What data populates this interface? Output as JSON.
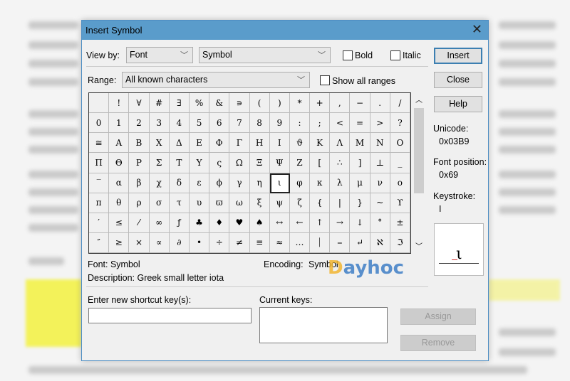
{
  "dialog": {
    "title": "Insert Symbol",
    "view_by_label": "View by:",
    "view_by_value": "Font",
    "font_value": "Symbol",
    "bold_label": "Bold",
    "italic_label": "Italic",
    "bold_checked": false,
    "italic_checked": false,
    "range_label": "Range:",
    "range_value": "All known characters",
    "show_all_ranges_label": "Show all ranges",
    "buttons": {
      "insert": "Insert",
      "close": "Close",
      "help": "Help",
      "assign": "Assign",
      "remove": "Remove"
    },
    "unicode_label": "Unicode:",
    "unicode_value": "0x03B9",
    "font_position_label": "Font position:",
    "font_position_value": "0x69",
    "keystroke_label": "Keystroke:",
    "keystroke_value": "I",
    "preview_char": "ι",
    "font_info": "Font: Symbol",
    "description": "Description: Greek small letter iota",
    "encoding_label": "Encoding:",
    "encoding_value": "Symbol",
    "shortcut_label": "Enter new shortcut key(s):",
    "shortcut_value": "",
    "current_keys_label": "Current keys:"
  },
  "symbols": [
    " ",
    "!",
    "∀",
    "#",
    "∃",
    "%",
    "&",
    "∍",
    "(",
    ")",
    "*",
    "+",
    ",",
    "−",
    ".",
    "/",
    "0",
    "1",
    "2",
    "3",
    "4",
    "5",
    "6",
    "7",
    "8",
    "9",
    ":",
    ";",
    "<",
    "=",
    ">",
    "?",
    "≅",
    "Α",
    "Β",
    "Χ",
    "Δ",
    "Ε",
    "Φ",
    "Γ",
    "Η",
    "Ι",
    "ϑ",
    "Κ",
    "Λ",
    "Μ",
    "Ν",
    "Ο",
    "Π",
    "Θ",
    "Ρ",
    "Σ",
    "Τ",
    "Υ",
    "ς",
    "Ω",
    "Ξ",
    "Ψ",
    "Ζ",
    "[",
    "∴",
    "]",
    "⊥",
    "_",
    "‾",
    "α",
    "β",
    "χ",
    "δ",
    "ε",
    "ϕ",
    "γ",
    "η",
    "ι",
    "φ",
    "κ",
    "λ",
    "μ",
    "ν",
    "ο",
    "π",
    "θ",
    "ρ",
    "σ",
    "τ",
    "υ",
    "ϖ",
    "ω",
    "ξ",
    "ψ",
    "ζ",
    "{",
    "|",
    "}",
    "~",
    "ϒ",
    "′",
    "≤",
    "⁄",
    "∞",
    "ƒ",
    "♣",
    "♦",
    "♥",
    "♠",
    "↔",
    "←",
    "↑",
    "→",
    "↓",
    "°",
    "±",
    "″",
    "≥",
    "×",
    "∝",
    "∂",
    "•",
    "÷",
    "≠",
    "≡",
    "≈",
    "…",
    "⏐",
    "⎯",
    "↵",
    "ℵ",
    "ℑ"
  ],
  "selected_index": 73,
  "watermark": "dayhoc"
}
